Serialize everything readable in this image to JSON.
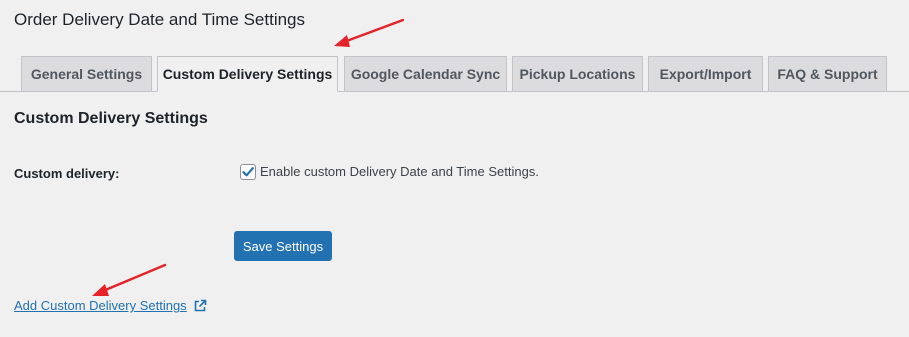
{
  "page": {
    "title": "Order Delivery Date and Time Settings"
  },
  "tabs": [
    {
      "label": "General Settings",
      "active": false
    },
    {
      "label": "Custom Delivery Settings",
      "active": true
    },
    {
      "label": "Google Calendar Sync",
      "active": false
    },
    {
      "label": "Pickup Locations",
      "active": false
    },
    {
      "label": "Export/Import",
      "active": false
    },
    {
      "label": "FAQ & Support",
      "active": false
    }
  ],
  "section": {
    "title": "Custom Delivery Settings"
  },
  "custom_delivery": {
    "label": "Custom delivery:",
    "checkbox_label": "Enable custom Delivery Date and Time Settings.",
    "checked": true
  },
  "save_button": {
    "label": "Save Settings"
  },
  "add_link": {
    "label": "Add Custom Delivery Settings",
    "icon": "external-link-icon"
  },
  "annotations": {
    "arrow_color": "#e5232a"
  },
  "colors": {
    "primary": "#2271b1",
    "background": "#f0f0f1",
    "tab_inactive": "#dcdcde"
  }
}
